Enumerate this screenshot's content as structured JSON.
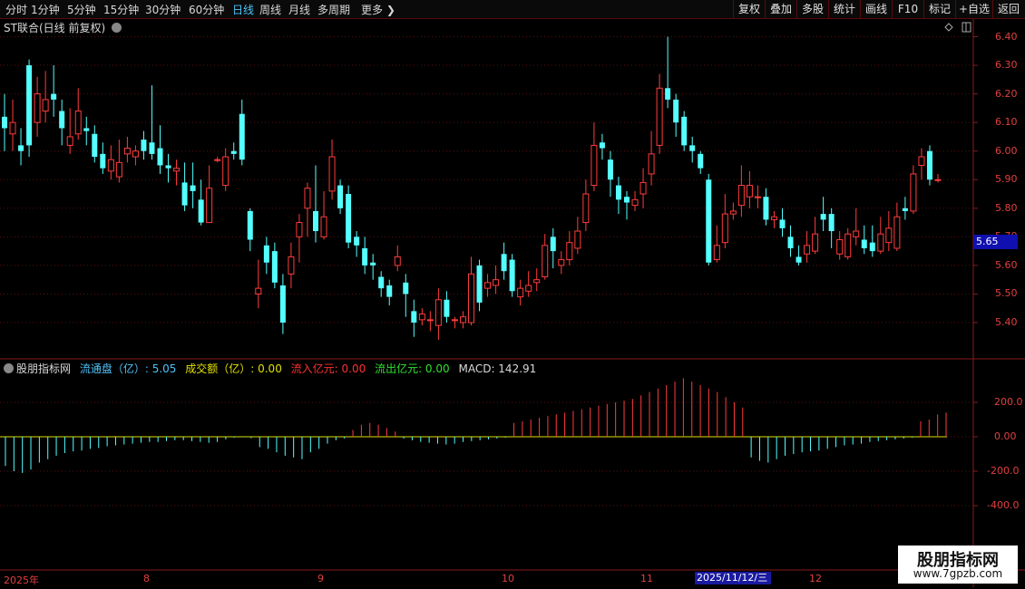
{
  "toolbar": {
    "periods": [
      "分时",
      "1分钟",
      "5分钟",
      "15分钟",
      "30分钟",
      "60分钟",
      "日线",
      "周线",
      "月线",
      "多周期",
      "更多"
    ],
    "active_period": "日线",
    "right_buttons": [
      "复权",
      "叠加",
      "多股",
      "统计",
      "画线",
      "F10",
      "标记",
      "+自选",
      "返回"
    ]
  },
  "chart_title": "ST联合(日线 前复权)",
  "price_axis": [
    "6.40",
    "6.30",
    "6.20",
    "6.10",
    "6.00",
    "5.90",
    "5.80",
    "5.70",
    "5.60",
    "5.50",
    "5.40"
  ],
  "current_price": "5.65",
  "indicator": {
    "name": "股朋指标网",
    "items": [
      {
        "label": "流通盘（亿）: ",
        "value": "5.05",
        "color": "#4fc3f7"
      },
      {
        "label": "成交额（亿）: ",
        "value": "0.00",
        "color": "#e0e000"
      },
      {
        "label": "流入亿元: ",
        "value": "0.00",
        "color": "#ff3030"
      },
      {
        "label": "流出亿元: ",
        "value": "0.00",
        "color": "#30e030"
      },
      {
        "label": "MACD: ",
        "value": "142.91",
        "color": "#d8d8d8"
      }
    ],
    "axis": [
      "200.0",
      "0.00",
      "-200.0",
      "-400.0"
    ]
  },
  "dates": [
    "2025年",
    "8",
    "9",
    "10",
    "11",
    "12"
  ],
  "highlight_date": "2025/11/12/三",
  "watermark": {
    "title": "股朋指标网",
    "url": "www.7gpzb.com"
  },
  "colors": {
    "up": "#ff3c3c",
    "down": "#54ffff",
    "background": "#000000"
  },
  "chart_data": [
    {
      "type": "candlestick",
      "ylim": [
        5.33,
        6.45
      ],
      "candles": [
        [
          6.12,
          6.08,
          6.2,
          6.0
        ],
        [
          6.06,
          6.1,
          6.18,
          6.0
        ],
        [
          6.02,
          6.0,
          6.08,
          5.95
        ],
        [
          6.3,
          6.02,
          6.32,
          5.98
        ],
        [
          6.1,
          6.2,
          6.26,
          6.05
        ],
        [
          6.14,
          6.18,
          6.28,
          6.1
        ],
        [
          6.2,
          6.18,
          6.3,
          6.12
        ],
        [
          6.14,
          6.08,
          6.18,
          6.02
        ],
        [
          6.02,
          6.05,
          6.15,
          5.99
        ],
        [
          6.06,
          6.14,
          6.22,
          6.04
        ],
        [
          6.08,
          6.07,
          6.12,
          6.02
        ],
        [
          6.06,
          5.98,
          6.09,
          5.96
        ],
        [
          5.99,
          5.94,
          6.03,
          5.92
        ],
        [
          5.93,
          5.97,
          6.02,
          5.9
        ],
        [
          5.91,
          5.96,
          6.04,
          5.89
        ],
        [
          5.99,
          6.01,
          6.05,
          5.96
        ],
        [
          5.98,
          6.0,
          6.02,
          5.95
        ],
        [
          6.04,
          6.0,
          6.07,
          5.97
        ],
        [
          6.03,
          5.99,
          6.23,
          5.97
        ],
        [
          6.01,
          5.95,
          6.09,
          5.92
        ],
        [
          5.95,
          5.94,
          5.99,
          5.89
        ],
        [
          5.93,
          5.94,
          5.97,
          5.88
        ],
        [
          5.89,
          5.81,
          5.96,
          5.79
        ],
        [
          5.88,
          5.86,
          5.96,
          5.8
        ],
        [
          5.83,
          5.75,
          5.9,
          5.74
        ],
        [
          5.75,
          5.87,
          5.95,
          5.75
        ],
        [
          5.97,
          5.97,
          5.98,
          5.96
        ],
        [
          5.88,
          5.98,
          6.01,
          5.86
        ],
        [
          6.0,
          5.99,
          6.03,
          5.97
        ],
        [
          6.13,
          5.97,
          6.18,
          5.95
        ],
        [
          5.79,
          5.69,
          5.8,
          5.65
        ],
        [
          5.5,
          5.52,
          5.62,
          5.45
        ],
        [
          5.67,
          5.61,
          5.7,
          5.57
        ],
        [
          5.65,
          5.54,
          5.68,
          5.52
        ],
        [
          5.53,
          5.4,
          5.57,
          5.36
        ],
        [
          5.57,
          5.63,
          5.68,
          5.52
        ],
        [
          5.7,
          5.75,
          5.78,
          5.61
        ],
        [
          5.8,
          5.87,
          5.89,
          5.7
        ],
        [
          5.79,
          5.72,
          5.95,
          5.68
        ],
        [
          5.7,
          5.77,
          5.86,
          5.69
        ],
        [
          5.86,
          5.98,
          6.04,
          5.83
        ],
        [
          5.88,
          5.8,
          5.9,
          5.78
        ],
        [
          5.85,
          5.68,
          5.88,
          5.66
        ],
        [
          5.7,
          5.67,
          5.72,
          5.63
        ],
        [
          5.66,
          5.6,
          5.7,
          5.57
        ],
        [
          5.61,
          5.6,
          5.64,
          5.55
        ],
        [
          5.56,
          5.52,
          5.58,
          5.49
        ],
        [
          5.53,
          5.49,
          5.55,
          5.46
        ],
        [
          5.6,
          5.63,
          5.67,
          5.58
        ],
        [
          5.54,
          5.5,
          5.57,
          5.42
        ],
        [
          5.44,
          5.4,
          5.48,
          5.35
        ],
        [
          5.41,
          5.43,
          5.45,
          5.39
        ],
        [
          5.41,
          5.41,
          5.44,
          5.37
        ],
        [
          5.39,
          5.48,
          5.52,
          5.34
        ],
        [
          5.48,
          5.42,
          5.51,
          5.4
        ],
        [
          5.41,
          5.41,
          5.42,
          5.38
        ],
        [
          5.4,
          5.42,
          5.44,
          5.38
        ],
        [
          5.4,
          5.57,
          5.63,
          5.39
        ],
        [
          5.6,
          5.47,
          5.62,
          5.44
        ],
        [
          5.52,
          5.54,
          5.57,
          5.49
        ],
        [
          5.53,
          5.55,
          5.6,
          5.5
        ],
        [
          5.64,
          5.58,
          5.68,
          5.55
        ],
        [
          5.62,
          5.51,
          5.64,
          5.49
        ],
        [
          5.49,
          5.52,
          5.55,
          5.46
        ],
        [
          5.51,
          5.53,
          5.58,
          5.49
        ],
        [
          5.54,
          5.55,
          5.59,
          5.51
        ],
        [
          5.56,
          5.67,
          5.71,
          5.55
        ],
        [
          5.7,
          5.65,
          5.73,
          5.59
        ],
        [
          5.6,
          5.62,
          5.65,
          5.57
        ],
        [
          5.62,
          5.68,
          5.72,
          5.6
        ],
        [
          5.66,
          5.72,
          5.77,
          5.64
        ],
        [
          5.75,
          5.85,
          5.9,
          5.72
        ],
        [
          5.88,
          6.02,
          6.1,
          5.86
        ],
        [
          6.03,
          6.01,
          6.06,
          5.97
        ],
        [
          5.97,
          5.9,
          6.0,
          5.84
        ],
        [
          5.88,
          5.83,
          5.91,
          5.78
        ],
        [
          5.84,
          5.82,
          5.86,
          5.76
        ],
        [
          5.81,
          5.83,
          5.86,
          5.79
        ],
        [
          5.85,
          5.89,
          5.94,
          5.8
        ],
        [
          5.92,
          5.99,
          6.07,
          5.88
        ],
        [
          6.02,
          6.22,
          6.27,
          5.99
        ],
        [
          6.22,
          6.18,
          6.4,
          6.15
        ],
        [
          6.18,
          6.1,
          6.2,
          6.05
        ],
        [
          6.12,
          6.02,
          6.14,
          6.0
        ],
        [
          6.02,
          6.0,
          6.05,
          5.96
        ],
        [
          5.99,
          5.94,
          6.0,
          5.92
        ],
        [
          5.9,
          5.61,
          5.92,
          5.6
        ],
        [
          5.62,
          5.67,
          5.74,
          5.61
        ],
        [
          5.68,
          5.78,
          5.85,
          5.66
        ],
        [
          5.78,
          5.79,
          5.82,
          5.76
        ],
        [
          5.81,
          5.88,
          5.95,
          5.77
        ],
        [
          5.84,
          5.88,
          5.93,
          5.8
        ],
        [
          5.84,
          5.84,
          5.88,
          5.8
        ],
        [
          5.84,
          5.76,
          5.87,
          5.74
        ],
        [
          5.76,
          5.77,
          5.79,
          5.73
        ],
        [
          5.76,
          5.73,
          5.8,
          5.7
        ],
        [
          5.7,
          5.66,
          5.74,
          5.63
        ],
        [
          5.63,
          5.61,
          5.67,
          5.6
        ],
        [
          5.64,
          5.67,
          5.72,
          5.61
        ],
        [
          5.65,
          5.71,
          5.77,
          5.64
        ],
        [
          5.78,
          5.76,
          5.84,
          5.72
        ],
        [
          5.78,
          5.72,
          5.8,
          5.66
        ],
        [
          5.64,
          5.69,
          5.72,
          5.62
        ],
        [
          5.63,
          5.71,
          5.73,
          5.62
        ],
        [
          5.7,
          5.72,
          5.8,
          5.67
        ],
        [
          5.69,
          5.66,
          5.74,
          5.64
        ],
        [
          5.68,
          5.65,
          5.74,
          5.63
        ],
        [
          5.65,
          5.71,
          5.77,
          5.64
        ],
        [
          5.68,
          5.73,
          5.79,
          5.65
        ],
        [
          5.66,
          5.77,
          5.82,
          5.65
        ],
        [
          5.8,
          5.79,
          5.84,
          5.76
        ],
        [
          5.79,
          5.92,
          5.95,
          5.78
        ],
        [
          5.95,
          5.98,
          6.01,
          5.9
        ],
        [
          6.0,
          5.9,
          6.02,
          5.88
        ],
        [
          5.9,
          5.9,
          5.92,
          5.89
        ]
      ],
      "macd": [
        -170,
        -200,
        -210,
        -190,
        -150,
        -130,
        -110,
        -95,
        -85,
        -80,
        -70,
        -65,
        -55,
        -50,
        -45,
        -40,
        -35,
        -30,
        -30,
        -25,
        -20,
        -20,
        -25,
        -30,
        -35,
        -30,
        -15,
        -5,
        -3,
        -8,
        -60,
        -70,
        -90,
        -110,
        -120,
        -130,
        -90,
        -70,
        -40,
        -20,
        -10,
        40,
        70,
        80,
        70,
        50,
        30,
        -10,
        -20,
        -30,
        -35,
        -40,
        -45,
        -40,
        -30,
        -25,
        -20,
        -15,
        -10,
        -5,
        80,
        90,
        100,
        110,
        120,
        130,
        140,
        150,
        160,
        170,
        180,
        190,
        200,
        210,
        220,
        240,
        260,
        280,
        300,
        320,
        340,
        320,
        300,
        280,
        260,
        230,
        200,
        170,
        -120,
        -140,
        -150,
        -130,
        -110,
        -100,
        -90,
        -85,
        -80,
        -70,
        -60,
        -50,
        -45,
        -40,
        -30,
        -25,
        -20,
        -15,
        -10,
        -5,
        90,
        100,
        130,
        140
      ],
      "macd_ylim": [
        -600,
        350
      ]
    }
  ]
}
